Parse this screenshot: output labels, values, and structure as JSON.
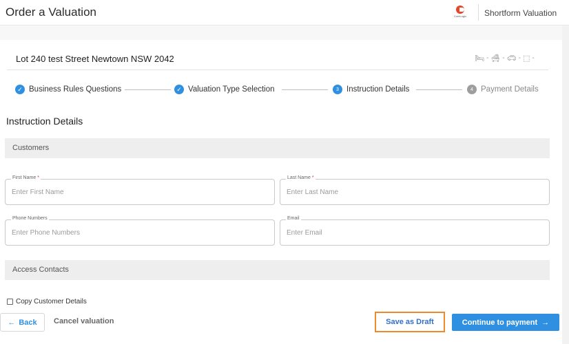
{
  "header": {
    "title": "Order a Valuation",
    "logo_text": "CoreLogic",
    "product": "Shortform Valuation"
  },
  "property": {
    "address": "Lot 240 test Street Newtown NSW 2042",
    "attributes": [
      {
        "icon": "bed-icon",
        "value": "-"
      },
      {
        "icon": "bath-icon",
        "value": "-"
      },
      {
        "icon": "car-icon",
        "value": "-"
      },
      {
        "icon": "land-size-icon",
        "value": "-"
      }
    ]
  },
  "stepper": {
    "steps": [
      {
        "label": "Business Rules Questions",
        "status": "complete",
        "marker": "✓"
      },
      {
        "label": "Valuation Type Selection",
        "status": "complete",
        "marker": "✓"
      },
      {
        "label": "Instruction Details",
        "status": "current",
        "marker": "3"
      },
      {
        "label": "Payment Details",
        "status": "pending",
        "marker": "4"
      }
    ]
  },
  "section_title": "Instruction Details",
  "customers": {
    "title": "Customers",
    "first_name": {
      "label": "First Name",
      "required_mark": "*",
      "placeholder": "Enter First Name",
      "value": ""
    },
    "last_name": {
      "label": "Last Name",
      "required_mark": "*",
      "placeholder": "Enter Last Name",
      "value": ""
    },
    "phone": {
      "label": "Phone Numbers",
      "placeholder": "Enter Phone Numbers",
      "value": ""
    },
    "email": {
      "label": "Email",
      "placeholder": "Enter Email",
      "value": ""
    }
  },
  "access_contacts": {
    "title": "Access Contacts",
    "copy_checkbox_label": "Copy Customer Details",
    "copy_checked": false
  },
  "footer": {
    "back_label": "Back",
    "cancel_label": "Cancel valuation",
    "draft_label": "Save as Draft",
    "continue_label": "Continue to payment"
  },
  "colors": {
    "accent": "#2f8fe0",
    "highlight_border": "#ef8a2c",
    "brand": "#e8442a"
  }
}
